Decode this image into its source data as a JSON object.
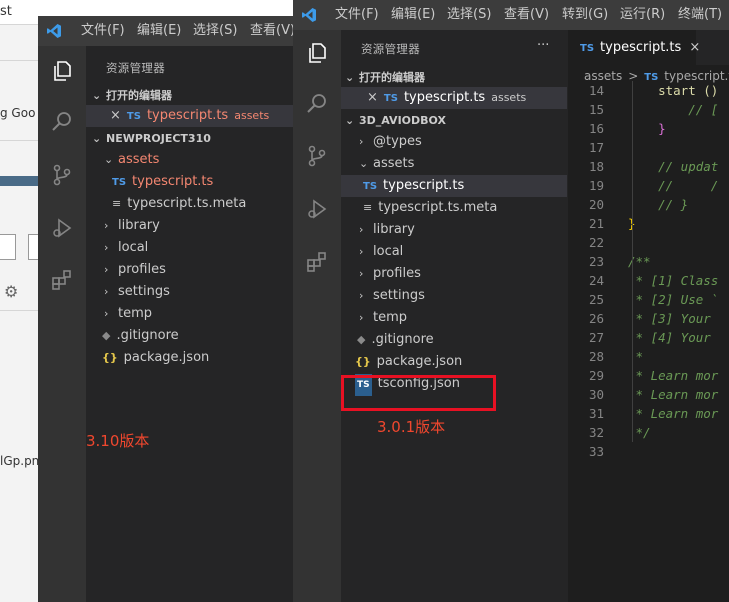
{
  "background_app": {
    "title_fragment": "st",
    "text_fragment_1": "g Goo",
    "text_fragment_2": "lGp.pn"
  },
  "left_window": {
    "menu": [
      "文件(F)",
      "编辑(E)",
      "选择(S)",
      "查看(V)"
    ],
    "explorer_title": "资源管理器",
    "open_editors_label": "打开的编辑器",
    "open_editor": {
      "icon": "TS",
      "name": "typescript.ts",
      "folder": "assets"
    },
    "project_label": "NEWPROJECT310",
    "tree": [
      {
        "name": "assets",
        "type": "folder-open"
      },
      {
        "name": "typescript.ts",
        "type": "ts"
      },
      {
        "name": "typescript.ts.meta",
        "type": "meta"
      },
      {
        "name": "library",
        "type": "folder"
      },
      {
        "name": "local",
        "type": "folder"
      },
      {
        "name": "profiles",
        "type": "folder"
      },
      {
        "name": "settings",
        "type": "folder"
      },
      {
        "name": "temp",
        "type": "folder"
      },
      {
        "name": ".gitignore",
        "type": "git"
      },
      {
        "name": "package.json",
        "type": "json"
      }
    ],
    "version_label": "3.10版本"
  },
  "right_window": {
    "menu": [
      "文件(F)",
      "编辑(E)",
      "选择(S)",
      "查看(V)",
      "转到(G)",
      "运行(R)",
      "终端(T)"
    ],
    "explorer_title": "资源管理器",
    "more_label": "···",
    "open_editors_label": "打开的编辑器",
    "open_editor": {
      "icon": "TS",
      "name": "typescript.ts",
      "folder": "assets"
    },
    "project_label": "3D_AVIODBOX",
    "tree": [
      {
        "name": "@types",
        "type": "folder"
      },
      {
        "name": "assets",
        "type": "folder-open"
      },
      {
        "name": "typescript.ts",
        "type": "ts"
      },
      {
        "name": "typescript.ts.meta",
        "type": "meta"
      },
      {
        "name": "library",
        "type": "folder"
      },
      {
        "name": "local",
        "type": "folder"
      },
      {
        "name": "profiles",
        "type": "folder"
      },
      {
        "name": "settings",
        "type": "folder"
      },
      {
        "name": "temp",
        "type": "folder"
      },
      {
        "name": ".gitignore",
        "type": "git"
      },
      {
        "name": "package.json",
        "type": "json"
      },
      {
        "name": "tsconfig.json",
        "type": "tsconfig"
      }
    ],
    "version_label": "3.0.1版本",
    "tab": {
      "icon": "TS",
      "name": "typescript.ts",
      "close": "×"
    },
    "breadcrumb": {
      "folder": "assets",
      "sep": ">",
      "icon": "TS",
      "file": "typescript.ts"
    },
    "code": [
      {
        "n": "14",
        "text": "    start ()"
      },
      {
        "n": "15",
        "text": "        // ["
      },
      {
        "n": "16",
        "text": "    }"
      },
      {
        "n": "17",
        "text": ""
      },
      {
        "n": "18",
        "text": "    // updat"
      },
      {
        "n": "19",
        "text": "    //     /"
      },
      {
        "n": "20",
        "text": "    // }"
      },
      {
        "n": "21",
        "text": "}"
      },
      {
        "n": "22",
        "text": ""
      },
      {
        "n": "23",
        "text": "/**"
      },
      {
        "n": "24",
        "text": " * [1] Class"
      },
      {
        "n": "25",
        "text": " * [2] Use `"
      },
      {
        "n": "26",
        "text": " * [3] Your"
      },
      {
        "n": "27",
        "text": " * [4] Your"
      },
      {
        "n": "28",
        "text": " *"
      },
      {
        "n": "29",
        "text": " * Learn mor"
      },
      {
        "n": "30",
        "text": " * Learn mor"
      },
      {
        "n": "31",
        "text": " * Learn mor"
      },
      {
        "n": "32",
        "text": " */"
      },
      {
        "n": "33",
        "text": ""
      }
    ]
  },
  "colors": {
    "highlight_box": "#e81123",
    "version_label": "#f0472e",
    "modified_file": "#f48771"
  }
}
